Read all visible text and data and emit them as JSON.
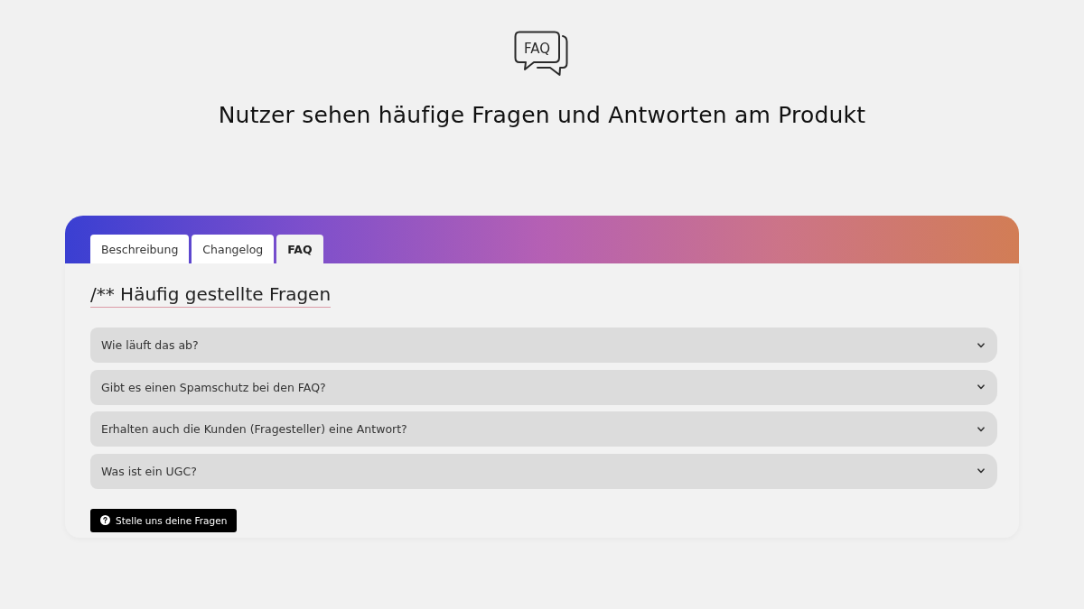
{
  "header": {
    "icon_text": "FAQ",
    "title": "Nutzer sehen häufige Fragen und Antworten am Produkt"
  },
  "tabs": [
    {
      "label": "Beschreibung",
      "selected": false
    },
    {
      "label": "Changelog",
      "selected": false
    },
    {
      "label": "FAQ",
      "selected": true
    }
  ],
  "section": {
    "heading": "/** Häufig gestellte Fragen"
  },
  "faq_items": [
    {
      "question": "Wie läuft das ab?",
      "expanded": false
    },
    {
      "question": "Gibt es einen Spamschutz bei den FAQ?",
      "expanded": false
    },
    {
      "question": "Erhalten auch die Kunden (Fragesteller) eine Antwort?",
      "expanded": false
    },
    {
      "question": "Was ist ein UGC?",
      "expanded": false
    }
  ],
  "ask_button": {
    "label": "Stelle uns deine Fragen"
  }
}
